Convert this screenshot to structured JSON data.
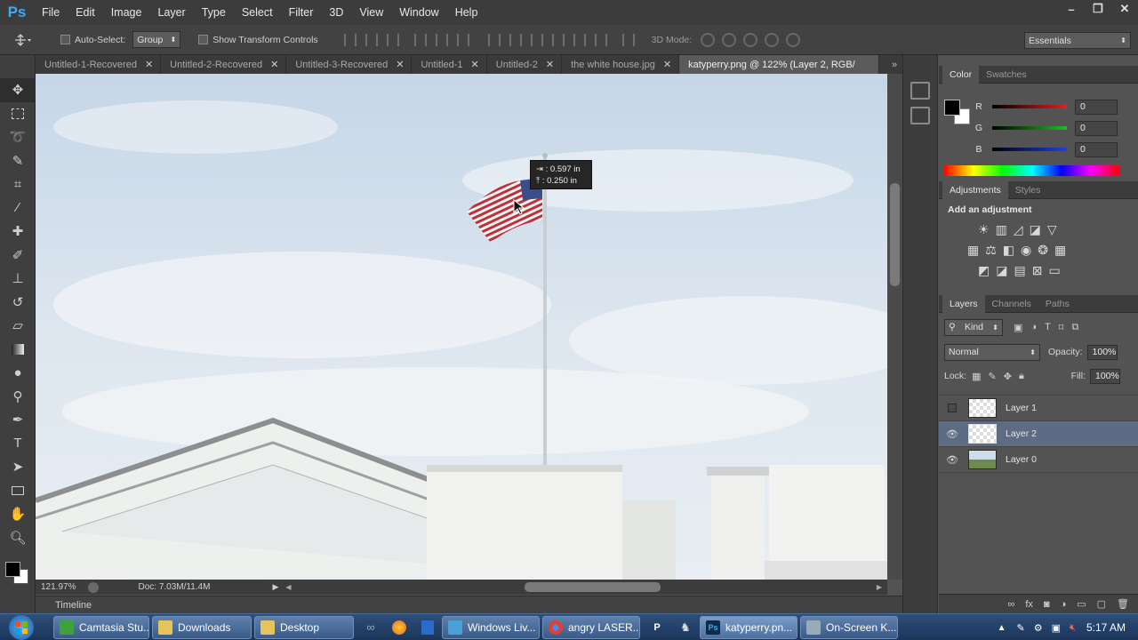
{
  "app": {
    "logo": "Ps"
  },
  "menu": [
    "File",
    "Edit",
    "Image",
    "Layer",
    "Type",
    "Select",
    "Filter",
    "3D",
    "View",
    "Window",
    "Help"
  ],
  "window_controls": [
    "–",
    "❐",
    "✕"
  ],
  "options": {
    "auto_select_label": "Auto-Select:",
    "auto_select_value": "Group",
    "show_transform_label": "Show Transform Controls",
    "mode3d_label": "3D Mode:",
    "workspace": "Essentials"
  },
  "tabs": [
    {
      "label": "Untitled-1-Recovered"
    },
    {
      "label": "Untitled-2-Recovered"
    },
    {
      "label": "Untitled-3-Recovered"
    },
    {
      "label": "Untitled-1"
    },
    {
      "label": "Untitled-2"
    },
    {
      "label": "the white house.jpg"
    },
    {
      "label": "katyperry.png @ 122% (Layer 2, RGB/"
    }
  ],
  "tooltip": {
    "width": "0.597 in",
    "height": "0.250 in"
  },
  "status": {
    "zoom": "121.97%",
    "doc": "Doc: 7.03M/11.4M"
  },
  "timeline_label": "Timeline",
  "color_panel": {
    "tabs": [
      "Color",
      "Swatches"
    ],
    "channels": [
      {
        "label": "R",
        "value": "0",
        "color": "#e02020"
      },
      {
        "label": "G",
        "value": "0",
        "color": "#20c020"
      },
      {
        "label": "B",
        "value": "0",
        "color": "#2040e0"
      }
    ]
  },
  "adjustments_panel": {
    "tabs": [
      "Adjustments",
      "Styles"
    ],
    "heading": "Add an adjustment"
  },
  "layers_panel": {
    "tabs": [
      "Layers",
      "Channels",
      "Paths"
    ],
    "kind_label": "Kind",
    "blend_mode": "Normal",
    "opacity_label": "Opacity:",
    "opacity_value": "100%",
    "lock_label": "Lock:",
    "fill_label": "Fill:",
    "fill_value": "100%",
    "layers": [
      {
        "name": "Layer 1",
        "visible": false,
        "selected": false
      },
      {
        "name": "Layer 2",
        "visible": true,
        "selected": true
      },
      {
        "name": "Layer 0",
        "visible": true,
        "selected": false
      }
    ]
  },
  "taskbar": {
    "buttons": [
      "Camtasia Stu...",
      "Downloads",
      "Desktop",
      "Windows Liv...",
      "angry LASER...",
      "katyperry.pn...",
      "On-Screen K..."
    ],
    "clock": "5:17 AM"
  }
}
